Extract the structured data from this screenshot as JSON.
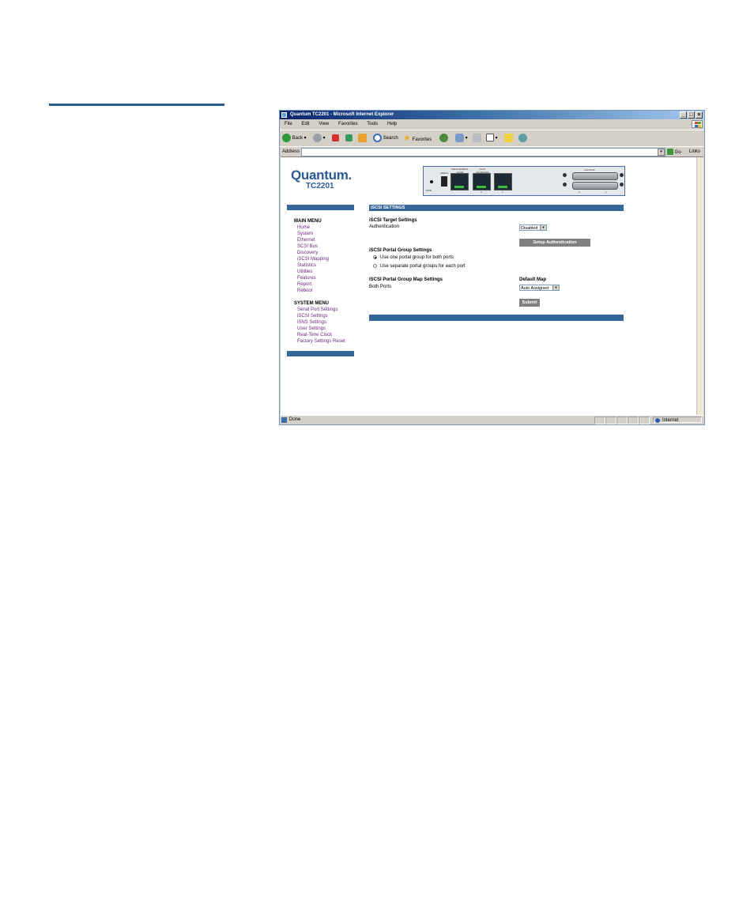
{
  "window": {
    "title": "Quantum TC2201 - Microsoft Internet Explorer"
  },
  "menubar": [
    "File",
    "Edit",
    "View",
    "Favorites",
    "Tools",
    "Help"
  ],
  "toolbar": {
    "back": "Back",
    "search": "Search",
    "favorites": "Favorites"
  },
  "addressbar": {
    "label": "Address",
    "value": "",
    "go": "Go",
    "links": "Links"
  },
  "brand": {
    "logo": "Quantum.",
    "model": "TC2201"
  },
  "panel": {
    "serial": "SERIAL",
    "management": "MANAGEMENT\n10/100",
    "iscsi": "iSCSI\n10/100/1000",
    "uw_scsi": "LVD SCSI",
    "pwr": "PWR",
    "port0": "0",
    "port1": "1",
    "scsi0": "0",
    "scsi1": "1"
  },
  "sidebar": {
    "main_menu_title": "MAIN MENU",
    "main_menu": [
      "Home",
      "System",
      "Ethernet",
      "SCSI Bus",
      "Discovery",
      "iSCSI Mapping",
      "Statistics",
      "Utilities",
      "Features",
      "Report",
      "Reboot"
    ],
    "system_menu_title": "SYSTEM MENU",
    "system_menu": [
      "Serial Port Settings",
      "iSCSI Settings",
      "iSNS Settings",
      "User Settings",
      "Real-Time Clock",
      "Factory Settings Reset"
    ]
  },
  "content": {
    "header": "iSCSI SETTINGS",
    "target_title": "iSCSI Target Settings",
    "auth_label": "Authentication",
    "auth_value": "Disabled",
    "setup_auth_button": "Setup Authentication",
    "portal_title": "iSCSI Portal Group Settings",
    "radio_one": "Use one portal group for both ports",
    "radio_separate": "Use separate portal groups for each port",
    "map_title": "iSCSI Portal Group Map Settings",
    "both_ports": "Both Ports",
    "default_map_label": "Default Map",
    "default_map_value": "Auto Assigned",
    "submit_button": "Submit"
  },
  "statusbar": {
    "status": "Done",
    "zone": "Internet"
  }
}
